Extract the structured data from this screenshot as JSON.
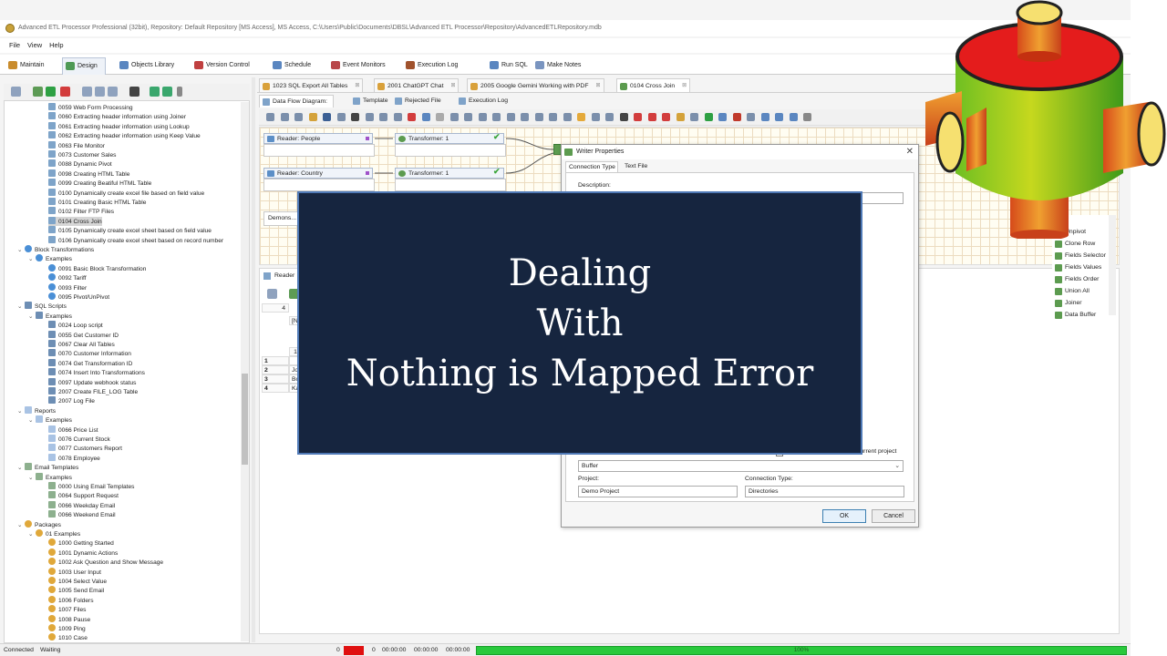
{
  "window": {
    "title": "Advanced ETL Processor Professional (32bit), Repository: Default Repository  [MS Access], MS Access, C:\\Users\\Public\\Documents\\DBSL\\Advanced ETL Processor\\Repository\\AdvancedETLRepository.mdb"
  },
  "menu": {
    "file": "File",
    "view": "View",
    "help": "Help"
  },
  "ribbon_tabs": [
    {
      "label": "Maintain",
      "color": "#c98c2d"
    },
    {
      "label": "Design",
      "color": "#4f9a55"
    },
    {
      "label": "Objects Library",
      "color": "#5a86c0"
    },
    {
      "label": "Version Control",
      "color": "#c04040"
    },
    {
      "label": "Schedule",
      "color": "#5a86c0"
    },
    {
      "label": "Event Monitors",
      "color": "#b8474a"
    },
    {
      "label": "Execution Log",
      "color": "#a0522d"
    },
    {
      "label": "Run SQL",
      "color": "#5a86c0"
    },
    {
      "label": "Make Notes",
      "color": "#7a95c0"
    }
  ],
  "tree": [
    {
      "label": "0059 Web Form Processing",
      "kind": "item",
      "level": 4
    },
    {
      "label": "0060 Extracting header information using Joiner",
      "kind": "item",
      "level": 4
    },
    {
      "label": "0061 Extracting header information using Lookup",
      "kind": "item",
      "level": 4
    },
    {
      "label": "0062 Extracting header information using Keep Value",
      "kind": "item",
      "level": 4
    },
    {
      "label": "0063 File Monitor",
      "kind": "item",
      "level": 4
    },
    {
      "label": "0073 Customer Sales",
      "kind": "item",
      "level": 4
    },
    {
      "label": "0088 Dynamic Pivot",
      "kind": "item",
      "level": 4
    },
    {
      "label": "0098 Creating HTML Table",
      "kind": "item",
      "level": 4
    },
    {
      "label": "0099 Creating Beatiful HTML Table",
      "kind": "item",
      "level": 4
    },
    {
      "label": "0100 Dynamically create excel file based on field value",
      "kind": "item",
      "level": 4
    },
    {
      "label": "0101 Creating Basic HTML Table",
      "kind": "item",
      "level": 4
    },
    {
      "label": "0102 Filter FTP Files",
      "kind": "item",
      "level": 4
    },
    {
      "label": "0104 Cross Join",
      "kind": "item",
      "level": 4,
      "selected": true
    },
    {
      "label": "0105 Dynamically create excel sheet based on field value",
      "kind": "item",
      "level": 4
    },
    {
      "label": "0106 Dynamically create excel sheet based on record number",
      "kind": "item",
      "level": 4
    },
    {
      "label": "Block Transformations",
      "kind": "block",
      "level": 2,
      "toggle": "v"
    },
    {
      "label": "Examples",
      "kind": "block",
      "level": 3,
      "toggle": "v"
    },
    {
      "label": "0091 Basic Block Transformation",
      "kind": "block",
      "level": 4
    },
    {
      "label": "0092 Tariff",
      "kind": "block",
      "level": 4
    },
    {
      "label": "0093 Filter",
      "kind": "block",
      "level": 4
    },
    {
      "label": "0095 Pivot/UnPivot",
      "kind": "block",
      "level": 4
    },
    {
      "label": "SQL Scripts",
      "kind": "sql",
      "level": 2,
      "toggle": "v"
    },
    {
      "label": "Examples",
      "kind": "sql",
      "level": 3,
      "toggle": "v"
    },
    {
      "label": "0024 Loop script",
      "kind": "sql",
      "level": 4
    },
    {
      "label": "0055 Get Customer ID",
      "kind": "sql",
      "level": 4
    },
    {
      "label": "0067 Clear All Tables",
      "kind": "sql",
      "level": 4
    },
    {
      "label": "0070 Customer Information",
      "kind": "sql",
      "level": 4
    },
    {
      "label": "0074 Get Transformation ID",
      "kind": "sql",
      "level": 4
    },
    {
      "label": "0074 Insert Into Transformations",
      "kind": "sql",
      "level": 4
    },
    {
      "label": "0097 Update webhook status",
      "kind": "sql",
      "level": 4
    },
    {
      "label": "2007 Create FILE_LOG Table",
      "kind": "sql",
      "level": 4
    },
    {
      "label": "2007 Log File",
      "kind": "sql",
      "level": 4
    },
    {
      "label": "Reports",
      "kind": "rep",
      "level": 2,
      "toggle": "v"
    },
    {
      "label": "Examples",
      "kind": "rep",
      "level": 3,
      "toggle": "v"
    },
    {
      "label": "0066 Price List",
      "kind": "rep",
      "level": 4
    },
    {
      "label": "0076 Current Stock",
      "kind": "rep",
      "level": 4
    },
    {
      "label": "0077 Customers Report",
      "kind": "rep",
      "level": 4
    },
    {
      "label": "0078 Employee",
      "kind": "rep",
      "level": 4
    },
    {
      "label": "Email Templates",
      "kind": "mail",
      "level": 2,
      "toggle": "v"
    },
    {
      "label": "Examples",
      "kind": "mail",
      "level": 3,
      "toggle": "v"
    },
    {
      "label": "0000 Using Email Templates",
      "kind": "mail",
      "level": 4
    },
    {
      "label": "0064 Support Request",
      "kind": "mail",
      "level": 4
    },
    {
      "label": "0066 Weekday Email",
      "kind": "mail",
      "level": 4
    },
    {
      "label": "0066 Weekend Email",
      "kind": "mail",
      "level": 4
    },
    {
      "label": "Packages",
      "kind": "pkg",
      "level": 2,
      "toggle": "v"
    },
    {
      "label": "01 Examples",
      "kind": "pkg",
      "level": 3,
      "toggle": "v"
    },
    {
      "label": "1000 Getting Started",
      "kind": "pkg",
      "level": 4
    },
    {
      "label": "1001 Dynamic Actions",
      "kind": "pkg",
      "level": 4
    },
    {
      "label": "1002 Ask Question and Show Message",
      "kind": "pkg",
      "level": 4
    },
    {
      "label": "1003 User Input",
      "kind": "pkg",
      "level": 4
    },
    {
      "label": "1004 Select Value",
      "kind": "pkg",
      "level": 4
    },
    {
      "label": "1005 Send Email",
      "kind": "pkg",
      "level": 4
    },
    {
      "label": "1006 Folders",
      "kind": "pkg",
      "level": 4
    },
    {
      "label": "1007 Files",
      "kind": "pkg",
      "level": 4
    },
    {
      "label": "1008 Pause",
      "kind": "pkg",
      "level": 4
    },
    {
      "label": "1009 Ping",
      "kind": "pkg",
      "level": 4
    },
    {
      "label": "1010 Case",
      "kind": "pkg",
      "level": 4
    }
  ],
  "doc_tabs": [
    {
      "label": "1023 SQL Export All Tables"
    },
    {
      "label": "2001 ChatGPT Chat"
    },
    {
      "label": "2005 Google Gemini Working with PDF"
    },
    {
      "label": "0104 Cross Join",
      "active": true
    }
  ],
  "sub_tabs": [
    {
      "label": "Data Flow Diagram:",
      "active": true
    },
    {
      "label": "Template"
    },
    {
      "label": "Rejected File"
    },
    {
      "label": "Execution Log"
    }
  ],
  "diagram": {
    "reader_people": "Reader: People",
    "reader_country": "Reader: Country",
    "transformer_1": "Transformer: 1",
    "transformer_2": "Transformer: 1",
    "note": "Demons..."
  },
  "lower_panel": {
    "tab_label": "Reader",
    "row_count": "4",
    "header_cell": "[N",
    "row_numbers": [
      "1",
      "2",
      "3",
      "4"
    ],
    "col_header": "1",
    "cells": [
      "",
      "Jo",
      "Bo",
      "Ka"
    ]
  },
  "palette": [
    "t",
    "Unpivot",
    "Clone Row",
    "Fields Selector",
    "Fields Values",
    "Fields Order",
    "Union All",
    "Joiner",
    "Data Buffer"
  ],
  "dialog": {
    "title": "Writer Properties",
    "tab_connection": "Connection Type",
    "tab_text": "Text File",
    "description_label": "Description:",
    "description_value": "",
    "current_project_label": "current project",
    "combo_value": "Buffer",
    "project_label": "Project:",
    "project_value": "Demo Project",
    "conn_type_label": "Connection Type:",
    "conn_type_value": "Directories",
    "ok": "OK",
    "cancel": "Cancel"
  },
  "overlay": {
    "line1": "Dealing",
    "line2": "With",
    "line3": "Nothing is Mapped Error"
  },
  "status": {
    "connected": "Connected",
    "waiting": "Waiting",
    "count_a": "0",
    "count_b": "0",
    "time1": "00:00:00",
    "time2": "00:00:00",
    "time3": "00:00:00",
    "progress_label": "100%",
    "progress_fraction": 1.0
  }
}
